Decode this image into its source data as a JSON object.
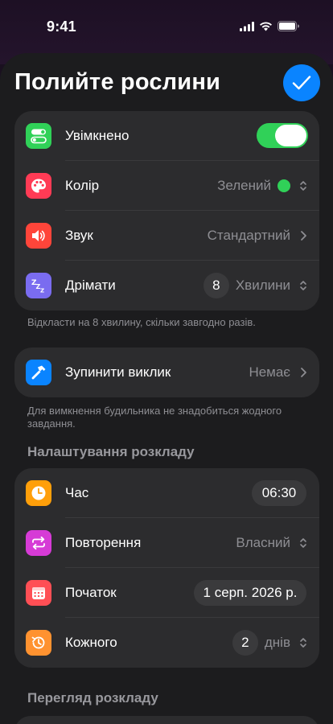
{
  "status_bar": {
    "time": "9:41"
  },
  "header": {
    "title": "Полийте рослини"
  },
  "alarm": {
    "enabled_label": "Увімкнено",
    "enabled": true,
    "color_label": "Колір",
    "color_value": "Зелений",
    "color_swatch": "#30d158",
    "sound_label": "Звук",
    "sound_value": "Стандартний",
    "snooze_label": "Дрімати",
    "snooze_count": "8",
    "snooze_unit": "Хвилини",
    "snooze_caption": "Відкласти на 8 хвилину, скільки завгодно разів."
  },
  "stop": {
    "label": "Зупинити виклик",
    "value": "Немає",
    "caption": "Для вимкнення будильника не знадобиться жодного завдання."
  },
  "schedule": {
    "header": "Налаштування розкладу",
    "time_label": "Час",
    "time_value": "06:30",
    "repeat_label": "Повторення",
    "repeat_value": "Власний",
    "start_label": "Початок",
    "start_value": "1 серп. 2026 р.",
    "every_label": "Кожного",
    "every_count": "2",
    "every_unit": "днів"
  },
  "preview": {
    "header": "Перегляд розкладу"
  }
}
